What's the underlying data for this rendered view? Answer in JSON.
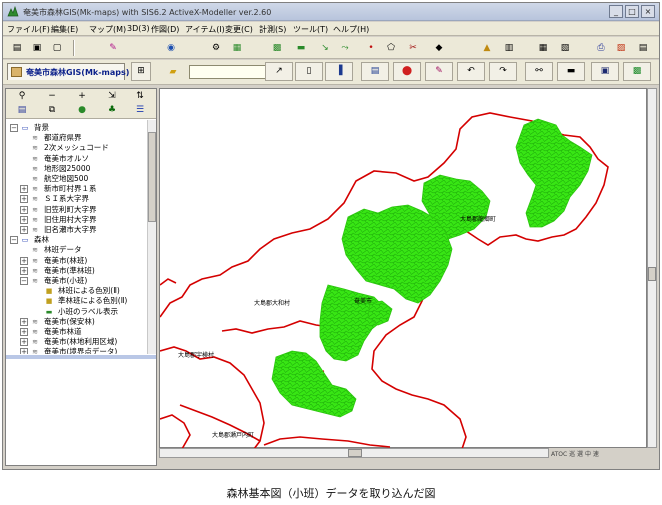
{
  "window": {
    "title": "奄美市森林GIS(Mk-maps) with SIS6.2 ActiveX-Modeller  ver.2.60",
    "minimize": "_",
    "maximize": "□",
    "close": "×"
  },
  "menu": [
    "ファイル(F)",
    "編集(E)",
    "マップ(M)",
    "3D(3)",
    "作図(D)",
    "アイテム(I)",
    "変更(C)",
    "計測(S)",
    "ツール(T)",
    "ヘルプ(H)"
  ],
  "map_tab": {
    "label": "奄美市森林GIS(Mk-maps)"
  },
  "tree": [
    {
      "label": "背景",
      "level": 0,
      "kind": "group",
      "state": "−"
    },
    {
      "label": "都道府県界",
      "level": 1,
      "kind": "layer"
    },
    {
      "label": "2次メッシュコード",
      "level": 1,
      "kind": "layer"
    },
    {
      "label": "奄美市オルソ",
      "level": 1,
      "kind": "layer"
    },
    {
      "label": "地形図25000",
      "level": 1,
      "kind": "layer"
    },
    {
      "label": "航空地図500",
      "level": 1,
      "kind": "layer"
    },
    {
      "label": "新市町村界１系",
      "level": 1,
      "kind": "layer",
      "state": "+"
    },
    {
      "label": "ＳＩ系大字界",
      "level": 1,
      "kind": "layer",
      "state": "+"
    },
    {
      "label": "旧笠利町大字界",
      "level": 1,
      "kind": "layer",
      "state": "+"
    },
    {
      "label": "旧住用村大字界",
      "level": 1,
      "kind": "layer",
      "state": "+"
    },
    {
      "label": "旧名瀬市大字界",
      "level": 1,
      "kind": "layer",
      "state": "+"
    },
    {
      "label": "森林",
      "level": 0,
      "kind": "group",
      "state": "−"
    },
    {
      "label": "林班データ",
      "level": 1,
      "kind": "layer"
    },
    {
      "label": "奄美市(林班)",
      "level": 1,
      "kind": "layer",
      "state": "+"
    },
    {
      "label": "奄美市(準林班)",
      "level": 1,
      "kind": "layer",
      "state": "+"
    },
    {
      "label": "奄美市(小班)",
      "level": 1,
      "kind": "layer",
      "state": "−"
    },
    {
      "label": "林班による色別(Ⅱ)",
      "level": 2,
      "kind": "theme"
    },
    {
      "label": "準林班による色別(Ⅱ)",
      "level": 2,
      "kind": "theme"
    },
    {
      "label": "小班のラベル表示",
      "level": 2,
      "kind": "label"
    },
    {
      "label": "奄美市(保安林)",
      "level": 1,
      "kind": "layer",
      "state": "+"
    },
    {
      "label": "奄美市林道",
      "level": 1,
      "kind": "layer",
      "state": "+"
    },
    {
      "label": "奄美市(林地利用区域)",
      "level": 1,
      "kind": "layer",
      "state": "+"
    },
    {
      "label": "奄美市(境界点データ)",
      "level": 1,
      "kind": "layer",
      "state": "+"
    }
  ],
  "map_labels": {
    "a": "大島郡龍郷町",
    "b": "大島郡大和村",
    "c": "奄美市",
    "d": "大島郡宇検村",
    "e": "大島郡瀬戸内町"
  },
  "status": "ATOC 巡 選 中 速",
  "caption": "森林基本図（小班）データを取り込んだ図",
  "colors": {
    "forest": "#38e614",
    "boundary": "#d40000",
    "tab_text": "#0a1f8a"
  }
}
